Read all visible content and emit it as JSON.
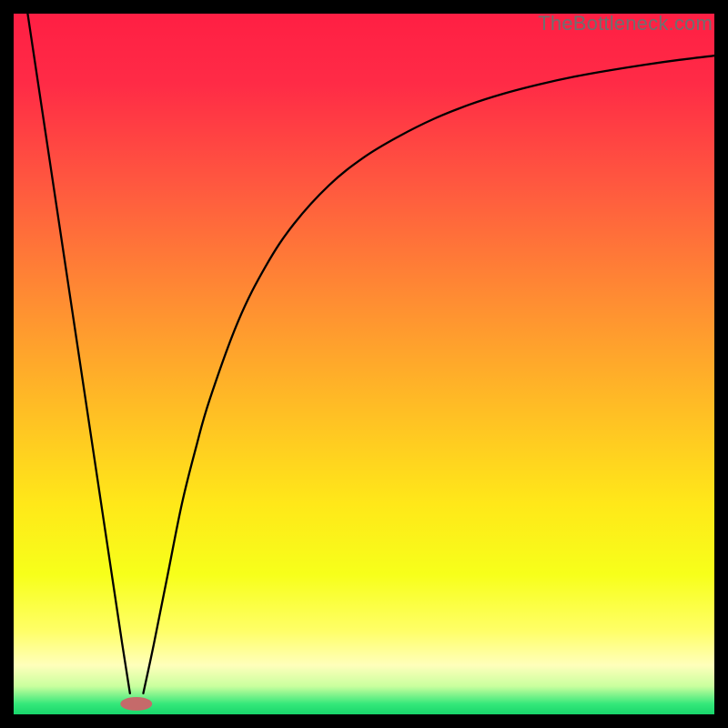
{
  "watermark": "TheBottleneck.com",
  "colors": {
    "gradient_stops": [
      {
        "offset": 0.0,
        "color": "#ff1f44"
      },
      {
        "offset": 0.1,
        "color": "#ff2b46"
      },
      {
        "offset": 0.25,
        "color": "#ff5a3f"
      },
      {
        "offset": 0.4,
        "color": "#ff8a33"
      },
      {
        "offset": 0.55,
        "color": "#ffb926"
      },
      {
        "offset": 0.7,
        "color": "#ffe819"
      },
      {
        "offset": 0.8,
        "color": "#f7ff1a"
      },
      {
        "offset": 0.88,
        "color": "#ffff66"
      },
      {
        "offset": 0.93,
        "color": "#ffffbb"
      },
      {
        "offset": 0.96,
        "color": "#c9ff9e"
      },
      {
        "offset": 0.985,
        "color": "#35e87a"
      },
      {
        "offset": 1.0,
        "color": "#18d66b"
      }
    ],
    "curve": "#000000",
    "marker_fill": "#c56a6a",
    "marker_stroke": "#c56a6a"
  },
  "chart_data": {
    "type": "line",
    "title": "",
    "xlabel": "",
    "ylabel": "",
    "xlim": [
      0,
      100
    ],
    "ylim": [
      0,
      100
    ],
    "grid": false,
    "legend": false,
    "series": [
      {
        "name": "left-branch",
        "x": [
          2,
          3.5,
          5,
          6.5,
          8,
          9.5,
          11,
          12.5,
          14,
          15.5,
          16.6
        ],
        "y": [
          100,
          90,
          80,
          70,
          60,
          50,
          40,
          30,
          20,
          10,
          3
        ]
      },
      {
        "name": "right-branch",
        "x": [
          18.5,
          20,
          22,
          24,
          26,
          28,
          32,
          36,
          40,
          45,
          50,
          55,
          60,
          65,
          70,
          75,
          80,
          85,
          90,
          95,
          100
        ],
        "y": [
          3,
          10,
          20,
          30,
          38,
          45,
          56,
          64,
          70,
          75.5,
          79.5,
          82.5,
          85,
          87,
          88.6,
          89.9,
          91,
          91.9,
          92.7,
          93.4,
          94
        ]
      }
    ],
    "marker": {
      "x": 17.5,
      "y": 1.5,
      "rx": 2.2,
      "ry": 0.9
    },
    "annotations": []
  }
}
